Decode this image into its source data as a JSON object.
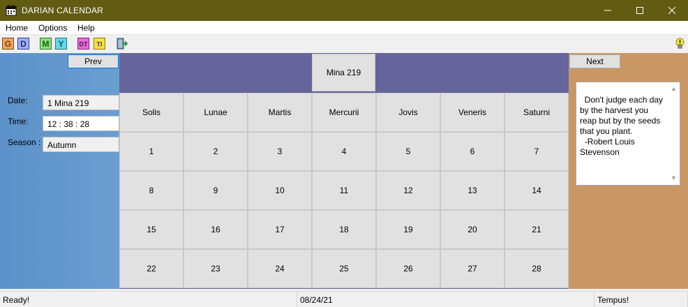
{
  "window": {
    "title": "DARIAN CALENDAR"
  },
  "menu": [
    "Home",
    "Options",
    "Help"
  ],
  "toolbar": {
    "icons": [
      "gregorian-icon",
      "darian-icon",
      "month-icon",
      "year-icon",
      "datetime-icon",
      "time-icon",
      "exit-icon",
      "tip-bulb-icon"
    ],
    "labels": [
      "G",
      "D",
      "M",
      "Y",
      "DT",
      "TI"
    ]
  },
  "nav": {
    "prev_label": "Prev",
    "next_label": "Next"
  },
  "fields": {
    "date_label": "Date:",
    "date_value": "1 Mina 219",
    "time_label": "Time:",
    "time_value": "12 : 38 : 28",
    "season_label": "Season :",
    "season_value": "Autumn"
  },
  "calendar": {
    "month_title": "Mina 219",
    "weekdays": [
      "Solis",
      "Lunae",
      "Martis",
      "Mercurii",
      "Jovis",
      "Veneris",
      "Saturni"
    ],
    "days": [
      "1",
      "2",
      "3",
      "4",
      "5",
      "6",
      "7",
      "8",
      "9",
      "10",
      "11",
      "12",
      "13",
      "14",
      "15",
      "16",
      "17",
      "18",
      "19",
      "20",
      "21",
      "22",
      "23",
      "24",
      "25",
      "26",
      "27",
      "28"
    ]
  },
  "quote": {
    "text": "Don't judge each day by the harvest you reap but by the seeds that you plant.\n  -Robert Louis Stevenson"
  },
  "status": {
    "left": "Ready!",
    "middle": "08/24/21",
    "right": "Tempus!"
  },
  "colors": {
    "titlebar": "#625c13",
    "left_panel": "#6299cc",
    "center_band": "#65659b",
    "right_panel": "#c99764"
  }
}
